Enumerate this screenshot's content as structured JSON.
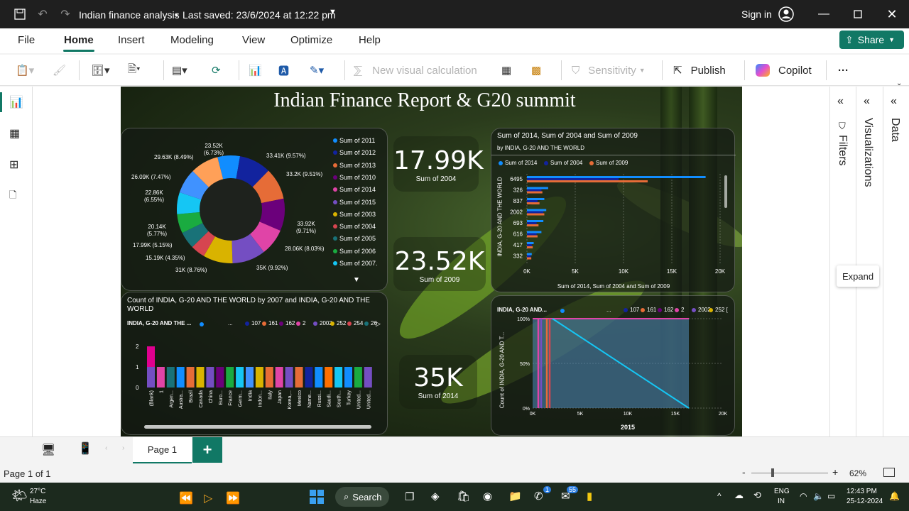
{
  "app": {
    "title": "Indian finance analysis",
    "saved": "Last saved: 23/6/2024 at 12:22 pm",
    "sign_in": "Sign in"
  },
  "menu": [
    "File",
    "Home",
    "Insert",
    "Modeling",
    "View",
    "Optimize",
    "Help"
  ],
  "share_label": "Share",
  "ribbon": {
    "new_visual_calc": "New visual calculation",
    "sensitivity": "Sensitivity",
    "publish": "Publish",
    "copilot": "Copilot",
    "more": "···"
  },
  "report": {
    "title": "Indian Finance Report & G20 summit"
  },
  "donut": {
    "legend": [
      "Sum of 2011",
      "Sum of 2012",
      "Sum of 2013",
      "Sum of 2010",
      "Sum of 2014",
      "Sum of 2015",
      "Sum of 2003",
      "Sum of 2004",
      "Sum of 2005",
      "Sum of 2006",
      "Sum of 2007."
    ],
    "colors": [
      "#118dff",
      "#12239e",
      "#e66c37",
      "#6b007b",
      "#e044a7",
      "#744ec2",
      "#d9b300",
      "#d64550",
      "#197278",
      "#1aab40",
      "#15c6f4",
      "#4092ff",
      "#ffa058"
    ],
    "labels": [
      "23.52K\n(6.73%)",
      "33.41K (9.57%)",
      "33.2K (9.51%)",
      "33.92K\n(9.71%)",
      "28.06K (8.03%)",
      "35K (9.92%)",
      "31K (8.76%)",
      "15.19K (4.35%)",
      "17.99K (5.15%)",
      "20.14K\n(5.77%)",
      "22.86K\n(6.55%)",
      "26.09K (7.47%)",
      "29.63K (8.49%)"
    ]
  },
  "kpis": [
    {
      "value": "17.99K",
      "caption": "Sum of 2004"
    },
    {
      "value": "23.52K",
      "caption": "Sum of 2009"
    },
    {
      "value": "35K",
      "caption": "Sum of 2014"
    }
  ],
  "hbar": {
    "title": "Sum of 2014, Sum of 2004 and Sum of 2009",
    "subtitle": "by INDIA, G-20 AND THE WORLD",
    "legend": [
      "Sum of 2014",
      "Sum of 2004",
      "Sum of 2009"
    ],
    "ylabel": "INDIA, G-20 AND THE WORLD",
    "xlabel": "Sum of 2014, Sum of 2004 and Sum of 2009",
    "ticks": [
      "0K",
      "5K",
      "10K",
      "15K",
      "20K"
    ]
  },
  "colchart": {
    "title": "Count of INDIA, G-20 AND THE WORLD by 2007 and INDIA, G-20 AND THE WORLD",
    "legend_title": "INDIA, G-20 AND THE ...",
    "legend": [
      "...",
      "107",
      "161",
      "162",
      "2",
      "2002",
      "252",
      "254",
      "26"
    ],
    "yticks": [
      "2",
      "1",
      "0"
    ]
  },
  "area": {
    "legend_title": "INDIA, G-20 AND...",
    "legend": [
      "...",
      "107",
      "161",
      "162",
      "2",
      "2002",
      "252 ["
    ],
    "ylabel": "Count of INDIA, G-20 AND T...",
    "yticks": [
      "100%",
      "50%",
      "0%"
    ],
    "xticks": [
      "0K",
      "5K",
      "10K",
      "15K",
      "20K"
    ],
    "xlabel": "2015"
  },
  "chart_data": [
    {
      "type": "pie",
      "title": "",
      "categories": [
        "Sum of 2011",
        "Sum of 2012",
        "Sum of 2013",
        "Sum of 2010",
        "Sum of 2014",
        "Sum of 2015",
        "Sum of 2003",
        "Sum of 2004",
        "Sum of 2005",
        "Sum of 2006",
        "Sum of 2007."
      ],
      "values": [
        23520,
        33410,
        33200,
        33920,
        28060,
        35000,
        31000,
        15190,
        17990,
        20140,
        22860,
        26090,
        29630
      ]
    },
    {
      "type": "bar",
      "title": "Sum of 2014, Sum of 2004 and Sum of 2009",
      "categories": [
        "6495",
        "326",
        "837",
        "2002",
        "693",
        "616",
        "417",
        "332"
      ],
      "series": [
        {
          "name": "Sum of 2014",
          "values": [
            18500,
            2200,
            1800,
            2000,
            1700,
            1500,
            700,
            500
          ]
        },
        {
          "name": "Sum of 2004",
          "values": [
            9500,
            1500,
            1100,
            1700,
            1000,
            1000,
            500,
            400
          ]
        },
        {
          "name": "Sum of 2009",
          "values": [
            12500,
            1600,
            1300,
            1800,
            1200,
            1100,
            600,
            450
          ]
        }
      ],
      "xlim": [
        0,
        20000
      ]
    },
    {
      "type": "bar",
      "title": "Count of INDIA, G-20 AND THE WORLD by 2007 and INDIA, G-20 AND THE WORLD",
      "categories": [
        "(Blank)",
        "1",
        "Argen...",
        "Austra...",
        "Brazil",
        "Canada",
        "China",
        "Euro...",
        "France",
        "Germ...",
        "India",
        "Indon...",
        "Italy",
        "Japan",
        "Korea,...",
        "Mexico",
        "Name...",
        "Russi...",
        "Saudi...",
        "South...",
        "Turkey",
        "United...",
        "United..."
      ],
      "values": [
        2,
        1,
        1,
        1,
        1,
        1,
        1,
        1,
        1,
        1,
        1,
        1,
        1,
        1,
        1,
        1,
        1,
        1,
        1,
        1,
        1,
        1,
        1
      ],
      "ylim": [
        0,
        2
      ]
    }
  ],
  "pages": {
    "tab": "Page 1",
    "add": "+"
  },
  "status": {
    "page": "Page 1 of 1",
    "zoom": "62%",
    "minus": "-",
    "plus": "+"
  },
  "side": {
    "filters": "Filters",
    "visualizations": "Visualizations",
    "data": "Data",
    "expand": "Expand"
  },
  "taskbar": {
    "temp": "27°C",
    "weather": "Haze",
    "search": "Search",
    "lang1": "ENG",
    "lang2": "IN",
    "time": "12:43 PM",
    "date": "25-12-2024",
    "badge1": "1",
    "badge2": "55"
  }
}
